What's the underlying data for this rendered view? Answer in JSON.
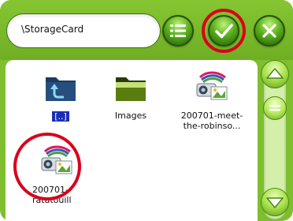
{
  "toolbar": {
    "path": "\\StorageCard",
    "buttons": [
      {
        "name": "view-list",
        "icon": "list-icon"
      },
      {
        "name": "confirm",
        "icon": "check-icon"
      },
      {
        "name": "close",
        "icon": "close-icon"
      }
    ]
  },
  "files": [
    {
      "label": "[..]",
      "type": "parent-folder",
      "icon": "folder-up-icon"
    },
    {
      "label": "Images",
      "type": "folder",
      "icon": "folder-icon"
    },
    {
      "label_line1": "200701-meet-",
      "label_line2": "the-robinso...",
      "type": "video",
      "icon": "video-file-icon"
    },
    {
      "label_line1": "200701-",
      "label_line2": "ratatouill",
      "type": "video",
      "icon": "video-file-icon"
    }
  ],
  "colors": {
    "brand_green": "#7fbe2e",
    "highlight_red": "#d9001b",
    "selection_blue": "#1b2fb5"
  },
  "scrollbar": {
    "up_icon": "arrow-up-icon",
    "down_icon": "arrow-down-icon",
    "thumb_icon": "drag-handle-icon"
  }
}
